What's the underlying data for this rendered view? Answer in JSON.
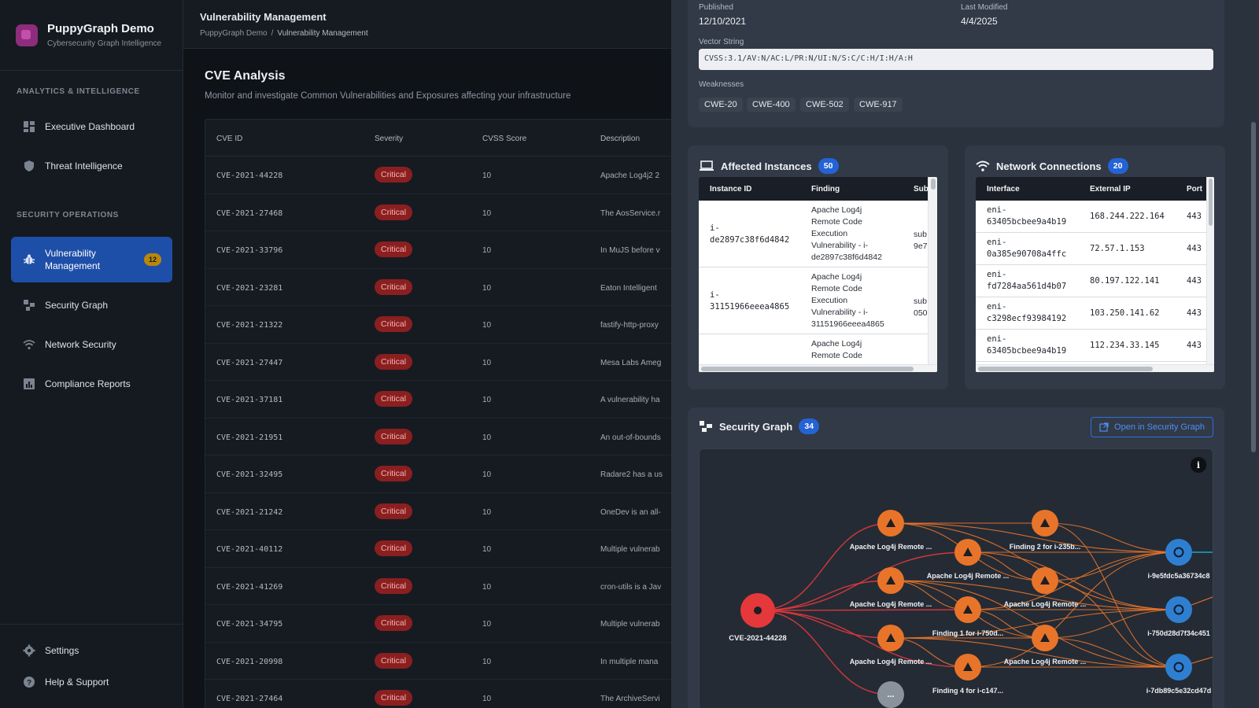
{
  "app": {
    "name": "PuppyGraph Demo",
    "subtitle": "Cybersecurity Graph Intelligence"
  },
  "sidebar": {
    "section1": "ANALYTICS & INTELLIGENCE",
    "section2": "SECURITY OPERATIONS",
    "items": [
      {
        "label": "Executive Dashboard",
        "icon": "dashboard-icon"
      },
      {
        "label": "Threat Intelligence",
        "icon": "shield-icon"
      },
      {
        "label": "Vulnerability Management",
        "icon": "bug-icon",
        "badge": "12",
        "active": true
      },
      {
        "label": "Security Graph",
        "icon": "graph-icon"
      },
      {
        "label": "Network Security",
        "icon": "wifi-icon"
      },
      {
        "label": "Compliance Reports",
        "icon": "report-icon"
      }
    ],
    "bottom": [
      {
        "label": "Settings",
        "icon": "gear-icon"
      },
      {
        "label": "Help & Support",
        "icon": "help-icon"
      }
    ]
  },
  "header": {
    "title": "Vulnerability Management",
    "breadcrumb": [
      "PuppyGraph Demo",
      "Vulnerability Management"
    ]
  },
  "page": {
    "title": "CVE Analysis",
    "subtitle": "Monitor and investigate Common Vulnerabilities and Exposures affecting your infrastructure"
  },
  "cve_table": {
    "columns": [
      "CVE ID",
      "Severity",
      "CVSS Score",
      "Description"
    ],
    "rows": [
      {
        "id": "CVE-2021-44228",
        "severity": "Critical",
        "score": "10",
        "desc": "Apache Log4j2 2"
      },
      {
        "id": "CVE-2021-27468",
        "severity": "Critical",
        "score": "10",
        "desc": "The AosService.r"
      },
      {
        "id": "CVE-2021-33796",
        "severity": "Critical",
        "score": "10",
        "desc": "In MuJS before v"
      },
      {
        "id": "CVE-2021-23281",
        "severity": "Critical",
        "score": "10",
        "desc": "Eaton Intelligent"
      },
      {
        "id": "CVE-2021-21322",
        "severity": "Critical",
        "score": "10",
        "desc": "fastify-http-proxy"
      },
      {
        "id": "CVE-2021-27447",
        "severity": "Critical",
        "score": "10",
        "desc": "Mesa Labs Ameg"
      },
      {
        "id": "CVE-2021-37181",
        "severity": "Critical",
        "score": "10",
        "desc": "A vulnerability ha"
      },
      {
        "id": "CVE-2021-21951",
        "severity": "Critical",
        "score": "10",
        "desc": "An out-of-bounds"
      },
      {
        "id": "CVE-2021-32495",
        "severity": "Critical",
        "score": "10",
        "desc": "Radare2 has a us"
      },
      {
        "id": "CVE-2021-21242",
        "severity": "Critical",
        "score": "10",
        "desc": "OneDev is an all-"
      },
      {
        "id": "CVE-2021-40112",
        "severity": "Critical",
        "score": "10",
        "desc": "Multiple vulnerab"
      },
      {
        "id": "CVE-2021-41269",
        "severity": "Critical",
        "score": "10",
        "desc": "cron-utils is a Jav"
      },
      {
        "id": "CVE-2021-34795",
        "severity": "Critical",
        "score": "10",
        "desc": "Multiple vulnerab"
      },
      {
        "id": "CVE-2021-20998",
        "severity": "Critical",
        "score": "10",
        "desc": "In multiple mana"
      },
      {
        "id": "CVE-2021-27464",
        "severity": "Critical",
        "score": "10",
        "desc": "The ArchiveServi"
      }
    ]
  },
  "details": {
    "published_label": "Published",
    "published": "12/10/2021",
    "modified_label": "Last Modified",
    "modified": "4/4/2025",
    "vector_label": "Vector String",
    "vector": "CVSS:3.1/AV:N/AC:L/PR:N/UI:N/S:C/C:H/I:H/A:H",
    "weaknesses_label": "Weaknesses",
    "weaknesses": [
      "CWE-20",
      "CWE-400",
      "CWE-502",
      "CWE-917"
    ]
  },
  "affected": {
    "title": "Affected Instances",
    "count": "50",
    "columns": [
      "Instance ID",
      "Finding",
      "Sub"
    ],
    "rows": [
      {
        "id_line1": "i-",
        "id_line2": "de2897c38f6d4842",
        "finding": [
          "Apache Log4j",
          "Remote Code",
          "Execution",
          "Vulnerability - i-",
          "de2897c38f6d4842"
        ],
        "sub": [
          "sub",
          "9e7"
        ]
      },
      {
        "id_line1": "i-",
        "id_line2": "31151966eeea4865",
        "finding": [
          "Apache Log4j",
          "Remote Code",
          "Execution",
          "Vulnerability - i-",
          "31151966eeea4865"
        ],
        "sub": [
          "sub",
          "050"
        ]
      },
      {
        "id_line1": "",
        "id_line2": "",
        "finding": [
          "Apache Log4j",
          "Remote Code"
        ],
        "sub": [
          "",
          ""
        ]
      }
    ]
  },
  "network": {
    "title": "Network Connections",
    "count": "20",
    "columns": [
      "Interface",
      "External IP",
      "Port"
    ],
    "rows": [
      {
        "if1": "eni-",
        "if2": "63405bcbee9a4b19",
        "ip": "168.244.222.164",
        "port": "443"
      },
      {
        "if1": "eni-",
        "if2": "0a385e90708a4ffc",
        "ip": "72.57.1.153",
        "port": "443"
      },
      {
        "if1": "eni-",
        "if2": "fd7284aa561d4b07",
        "ip": "80.197.122.141",
        "port": "443"
      },
      {
        "if1": "eni-",
        "if2": "c3298ecf93984192",
        "ip": "103.250.141.62",
        "port": "443"
      },
      {
        "if1": "eni-",
        "if2": "63405bcbee9a4b19",
        "ip": "112.234.33.145",
        "port": "443"
      }
    ]
  },
  "graph": {
    "title": "Security Graph",
    "count": "34",
    "open_label": "Open in Security Graph",
    "colors": {
      "cve": "#e5383b",
      "finding": "#e8742a",
      "instance": "#2f7fd1",
      "more": "#8a929c"
    },
    "nodes": {
      "root": "CVE-2021-44228",
      "findings": [
        "Apache Log4j Remote ...",
        "Finding 2 for i-235b...",
        "Apache Log4j Remote ...",
        "Apache Log4j Remote ...",
        "Apache Log4j Remote ...",
        "Finding 1 for i-750d...",
        "Apache Log4j Remote ...",
        "Apache Log4j Remote ...",
        "Finding 4 for i-c147..."
      ],
      "instances": [
        "i-9e5fdc5a36734c8",
        "i-750d28d7f34c451",
        "i-7db89c5e32cd47d"
      ],
      "more": "..."
    }
  }
}
